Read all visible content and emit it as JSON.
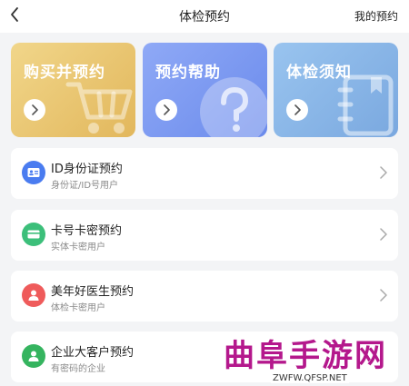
{
  "header": {
    "title": "体检预约",
    "my_booking": "我的预约"
  },
  "cards": [
    {
      "label": "购买并预约",
      "icon": "cart-icon"
    },
    {
      "label": "预约帮助",
      "icon": "question-icon"
    },
    {
      "label": "体检须知",
      "icon": "notebook-icon"
    }
  ],
  "list": [
    {
      "name": "ID身份证预约",
      "sub": "身份证/ID号用户",
      "color": "#4a7cf0",
      "icon": "id-card-icon"
    },
    {
      "name": "卡号卡密预约",
      "sub": "实体卡密用户",
      "color": "#3cbf7a",
      "icon": "card-icon"
    },
    {
      "name": "美年好医生预约",
      "sub": "体检卡密用户",
      "color": "#ef5b5b",
      "icon": "user-icon"
    },
    {
      "name": "企业大客户预约",
      "sub": "有密码的企业",
      "color": "#35b45f",
      "icon": "user-icon"
    }
  ],
  "watermark": {
    "main": "曲阜手游网",
    "sub": "ZWFW.QFSP.NET"
  }
}
